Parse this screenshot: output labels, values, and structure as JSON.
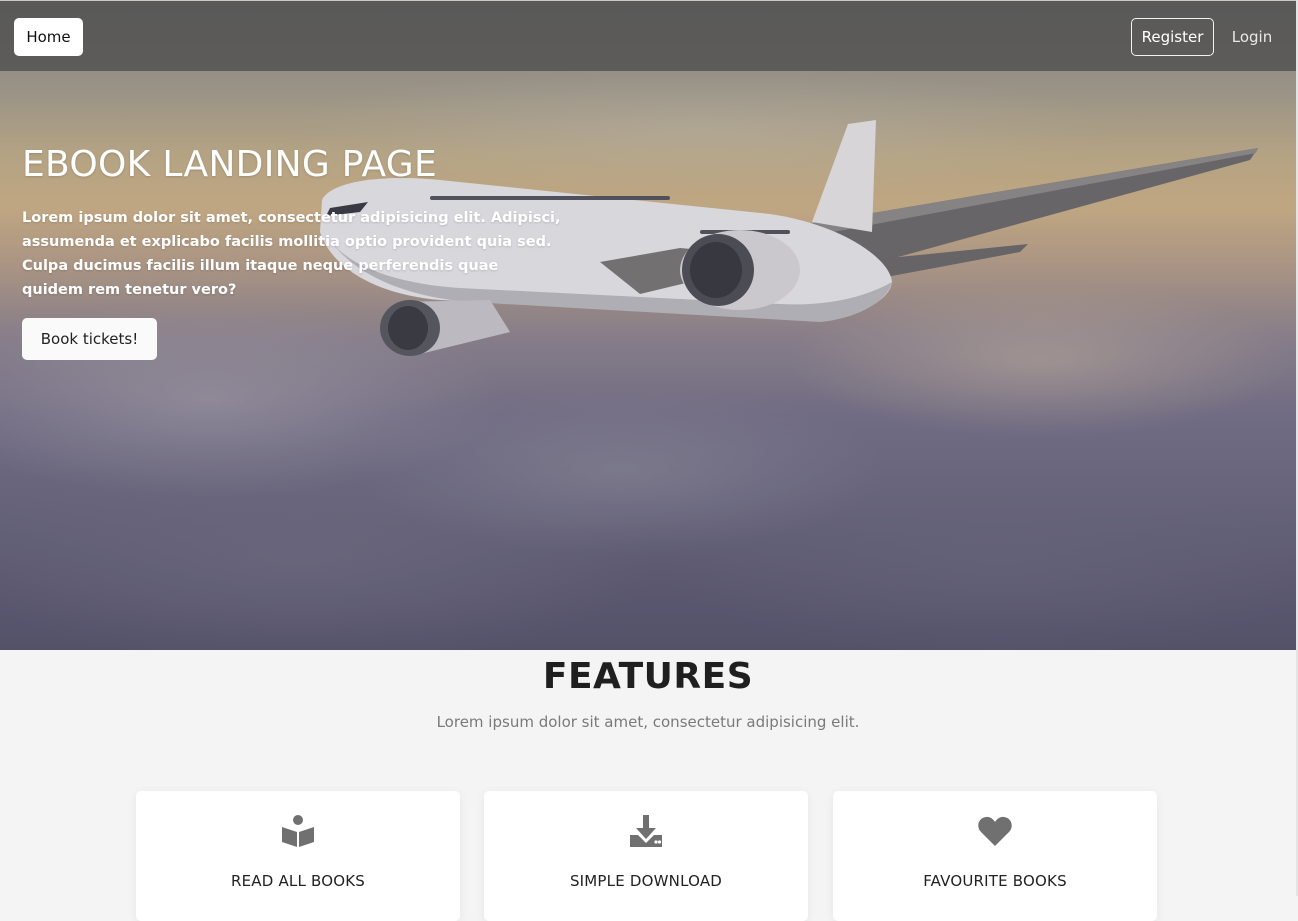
{
  "navbar": {
    "home_label": "Home",
    "register_label": "Register",
    "login_label": "Login"
  },
  "hero": {
    "title": "EBOOK LANDING PAGE",
    "text": "Lorem ipsum dolor sit amet, consectetur adipisicing elit. Adipisci, assumenda et explicabo facilis mollitia optio provident quia sed. Culpa ducimus facilis illum itaque neque perferendis quae quidem rem tenetur vero?",
    "cta_label": "Book tickets!"
  },
  "features": {
    "title": "FEATURES",
    "subtitle": "Lorem ipsum dolor sit amet, consectetur adipisicing elit.",
    "cards": [
      {
        "icon": "book-reader-icon",
        "title": "READ ALL BOOKS"
      },
      {
        "icon": "download-icon",
        "title": "SIMPLE DOWNLOAD"
      },
      {
        "icon": "heart-icon",
        "title": "FAVOURITE BOOKS"
      }
    ]
  },
  "colors": {
    "nav_background": "#505050",
    "icon_gray": "#707070",
    "page_background": "#f4f4f4"
  }
}
